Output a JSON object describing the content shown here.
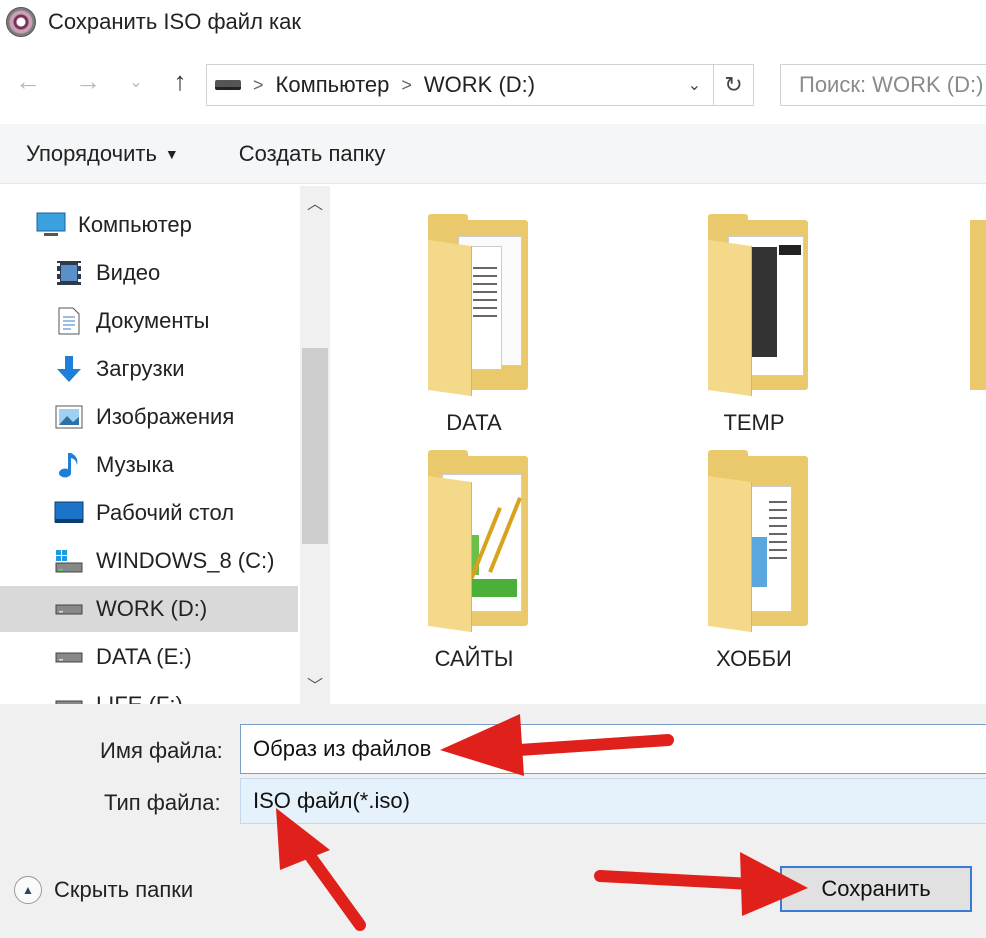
{
  "window": {
    "title": "Сохранить ISO файл как"
  },
  "nav": {
    "back": "←",
    "forward": "→",
    "recent": "⌄",
    "up": "↑",
    "refresh": "↻",
    "dropdown": "⌄"
  },
  "address": {
    "sep": ">",
    "crumbs": [
      "Компьютер",
      "WORK (D:)"
    ]
  },
  "search": {
    "placeholder": "Поиск: WORK (D:)"
  },
  "toolbar": {
    "organize": "Упорядочить",
    "organize_arrow": "▼",
    "new_folder": "Создать папку"
  },
  "sidebar": {
    "items": [
      {
        "label": "Компьютер",
        "icon": "computer-icon"
      },
      {
        "label": "Видео",
        "icon": "video-icon"
      },
      {
        "label": "Документы",
        "icon": "documents-icon"
      },
      {
        "label": "Загрузки",
        "icon": "downloads-icon"
      },
      {
        "label": "Изображения",
        "icon": "pictures-icon"
      },
      {
        "label": "Музыка",
        "icon": "music-icon"
      },
      {
        "label": "Рабочий стол",
        "icon": "desktop-icon"
      },
      {
        "label": "WINDOWS_8 (C:)",
        "icon": "windows-drive-icon"
      },
      {
        "label": "WORK (D:)",
        "icon": "drive-icon",
        "selected": true
      },
      {
        "label": "DATA (E:)",
        "icon": "drive-icon"
      },
      {
        "label": "LIFE (F:)",
        "icon": "drive-icon"
      }
    ],
    "scroll_up": "︿",
    "scroll_down": "﹀"
  },
  "files": [
    {
      "name": "DATA"
    },
    {
      "name": "TEMP"
    },
    {
      "name": "САЙТЫ"
    },
    {
      "name": "ХОББИ"
    }
  ],
  "form": {
    "filename_label": "Имя файла:",
    "filename_value": "Образ из файлов",
    "filetype_label": "Тип файла:",
    "filetype_value": "ISO файл(*.iso)"
  },
  "footer": {
    "hide_folders": "Скрыть папки",
    "hide_icon": "▲",
    "save": "Сохранить"
  },
  "colors": {
    "accent": "#3a7bd5",
    "annotation_arrow": "#e0201b",
    "folder": "#e9c96b"
  }
}
